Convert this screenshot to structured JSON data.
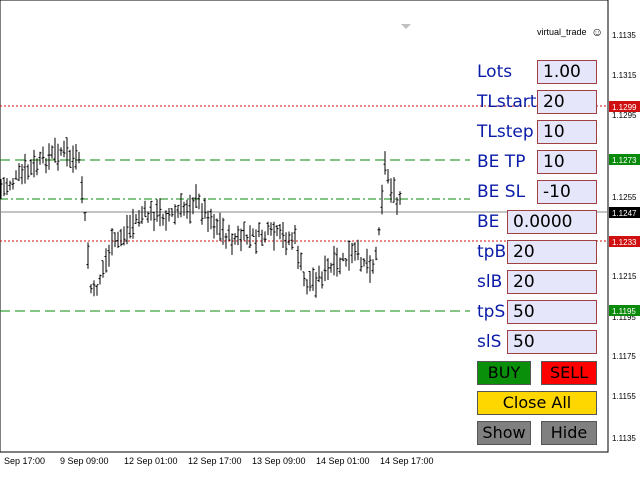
{
  "ea_name": "virtual_trade",
  "price_axis": {
    "labels": [
      "1.1135",
      "1.1315",
      "1.1295",
      "1.1255",
      "1.1215",
      "1.1195",
      "1.1175",
      "1.1155",
      "1.1135"
    ]
  },
  "time_axis": {
    "labels": [
      "Sep 17:00",
      "9 Sep 09:00",
      "12 Sep 01:00",
      "12 Sep 17:00",
      "13 Sep 09:00",
      "14 Sep 01:00",
      "14 Sep 17:00"
    ]
  },
  "price_tags": [
    {
      "text": "1.1299",
      "color": "#d01010"
    },
    {
      "text": "1.1273",
      "color": "#0a8a0a"
    },
    {
      "text": "1.1247",
      "color": "#000000"
    },
    {
      "text": "1.1233",
      "color": "#d01010"
    },
    {
      "text": "1.1195",
      "color": "#0a8a0a"
    }
  ],
  "panel": {
    "fields": [
      {
        "label": "Lots",
        "value": "1.00"
      },
      {
        "label": "TLstart",
        "value": "20"
      },
      {
        "label": "TLstep",
        "value": "10"
      },
      {
        "label": "BE TP",
        "value": "10"
      },
      {
        "label": "BE SL",
        "value": "-10"
      },
      {
        "label": "BE",
        "value": "0.0000"
      },
      {
        "label": "tpB",
        "value": "20"
      },
      {
        "label": "slB",
        "value": "20"
      },
      {
        "label": "tpS",
        "value": "50"
      },
      {
        "label": "slS",
        "value": "50"
      }
    ],
    "buttons": {
      "buy": "BUY",
      "sell": "SELL",
      "close_all": "Close All",
      "show": "Show",
      "hide": "Hide"
    }
  },
  "colors": {
    "label_blue": "#0a1ba8",
    "field_bg": "#e6e6fa",
    "buy_green": "#0a8f0a",
    "sell_red": "#ff0000",
    "close_yellow": "#ffd700",
    "gray_button": "#808080",
    "line_red": "#d01010",
    "line_green": "#0a8a0a"
  },
  "icons": {
    "ea_smiley": "smiley-icon",
    "scroll_marker": "triangle-down-icon"
  }
}
